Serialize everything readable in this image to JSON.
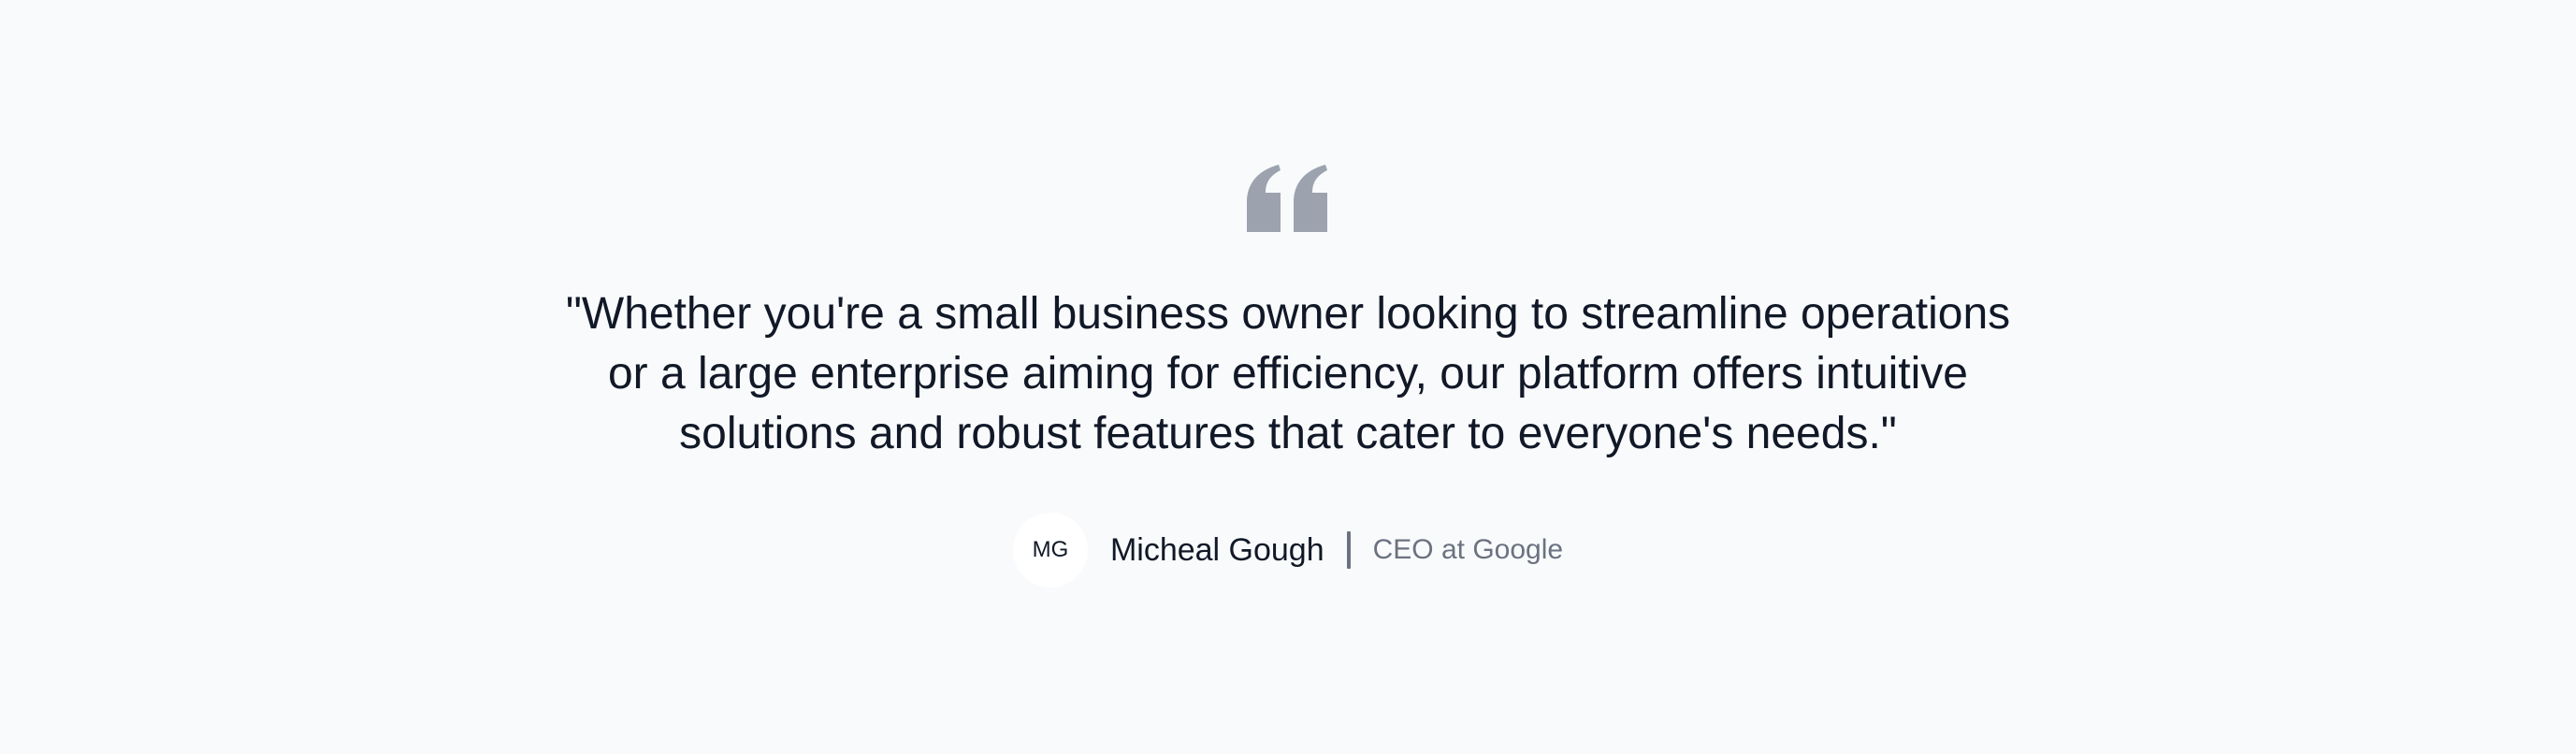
{
  "testimonial": {
    "quote": "\"Whether you're a small business owner looking to streamline operations or a large enterprise aiming for efficiency, our platform offers intuitive solutions and robust features that cater to everyone's needs.\"",
    "quote_icon": "quote-icon",
    "author": {
      "initials": "MG",
      "name": "Micheal Gough",
      "title": "CEO at Google"
    }
  },
  "colors": {
    "background": "#f9fafb",
    "text": "#111827",
    "muted": "#6b7280",
    "icon": "#9ca3af",
    "avatar_bg": "#ffffff"
  }
}
